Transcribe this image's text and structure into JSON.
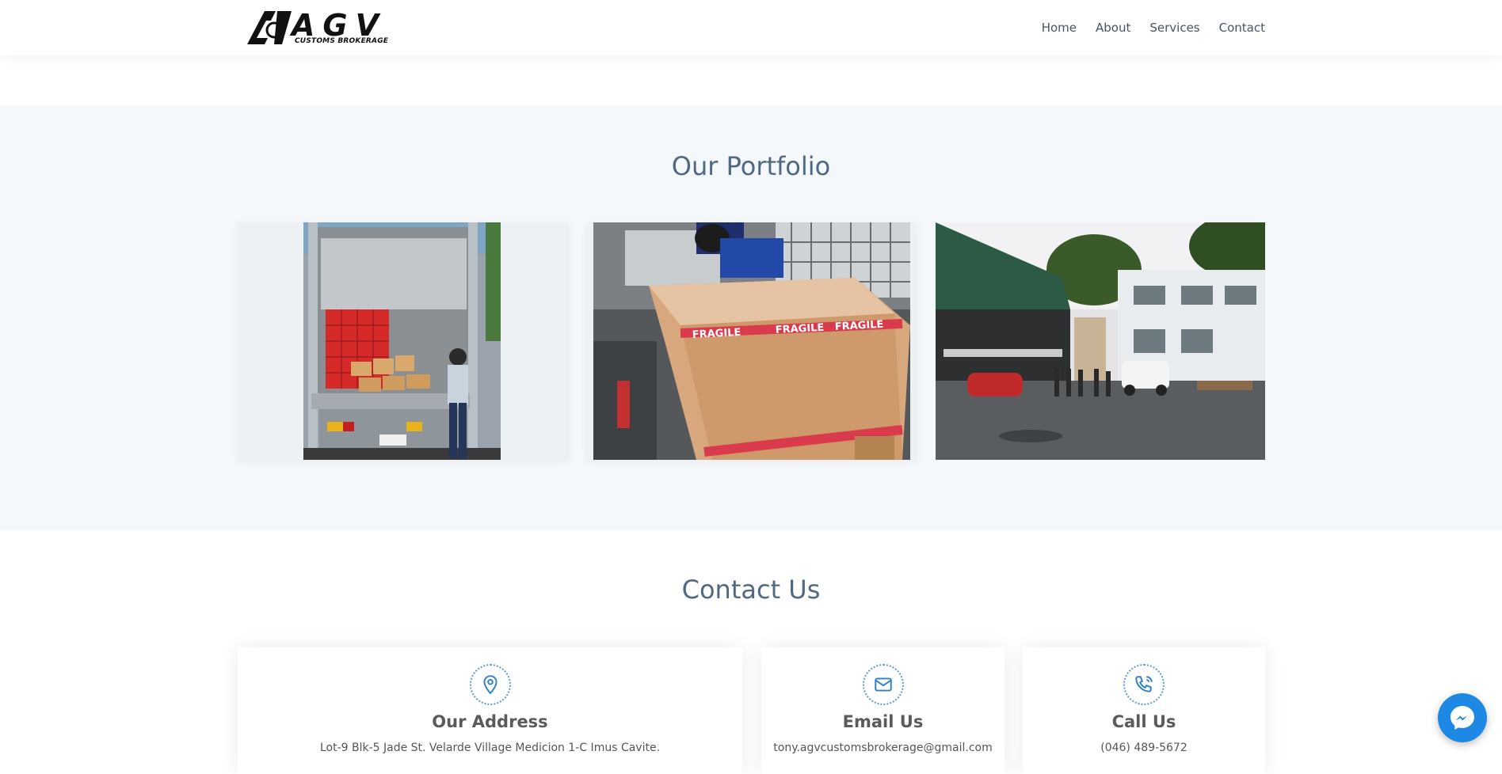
{
  "brand": {
    "logo_text": "AGV",
    "logo_subtitle": "CUSTOMS BROKERAGE"
  },
  "nav": {
    "items": [
      {
        "label": "Home"
      },
      {
        "label": "About"
      },
      {
        "label": "Services"
      },
      {
        "label": "Contact"
      }
    ]
  },
  "portfolio": {
    "title": "Our Portfolio",
    "images": [
      {
        "icon": "truck-loading-photo"
      },
      {
        "icon": "fragile-crate-photo"
      },
      {
        "icon": "warehouse-yard-photo"
      }
    ]
  },
  "contact": {
    "title": "Contact Us",
    "boxes": [
      {
        "icon": "map-pin-icon",
        "title": "Our Address",
        "text": "Lot-9 Blk-5 Jade St. Velarde Village Medicion 1-C Imus Cavite."
      },
      {
        "icon": "envelope-icon",
        "title": "Email Us",
        "text": "tony.agvcustomsbrokerage@gmail.com"
      },
      {
        "icon": "phone-icon",
        "title": "Call Us",
        "text": "(046) 489-5672"
      }
    ]
  },
  "colors": {
    "accent": "#1e88e5",
    "title": "#4f6883",
    "section_bg": "#f5f8fb"
  }
}
